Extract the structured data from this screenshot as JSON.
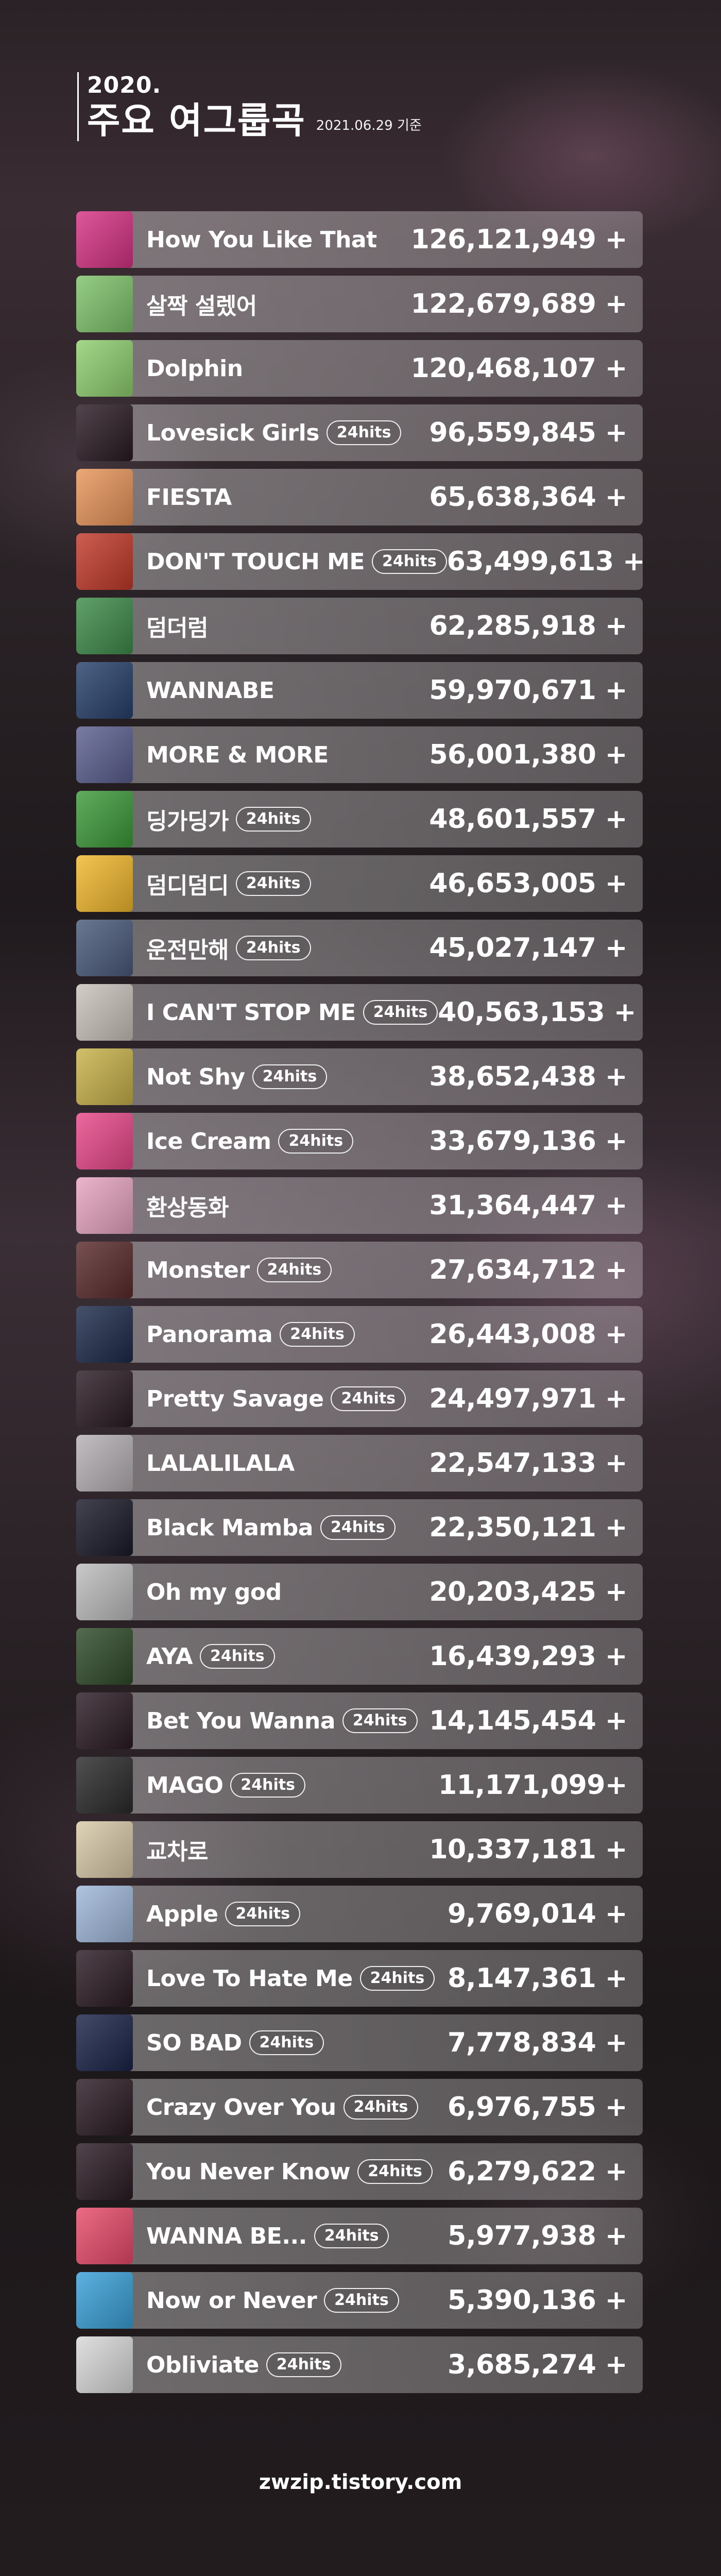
{
  "header": {
    "year": "2020.",
    "title": "주요 여그룹곡",
    "date": "2021.06.29 기준"
  },
  "songs": [
    {
      "title": "How You Like That",
      "badge": "",
      "count": "126,121,949 +",
      "thumb_color": "#d63384"
    },
    {
      "title": "살짝 설렜어",
      "badge": "",
      "count": "122,679,689 +",
      "thumb_color": "#7fc36b"
    },
    {
      "title": "Dolphin",
      "badge": "",
      "count": "120,468,107 +",
      "thumb_color": "#8fcf70"
    },
    {
      "title": "Lovesick Girls",
      "badge": "24hits",
      "count": "96,559,845 +",
      "thumb_color": "#2b1b24"
    },
    {
      "title": "FIESTA",
      "badge": "",
      "count": "65,638,364 +",
      "thumb_color": "#e8955a"
    },
    {
      "title": "DON'T TOUCH ME",
      "badge": "24hits",
      "count": "63,499,613 +",
      "thumb_color": "#c23a2a"
    },
    {
      "title": "덤더럼",
      "badge": "",
      "count": "62,285,918 +",
      "thumb_color": "#3e8b4a"
    },
    {
      "title": "WANNABE",
      "badge": "",
      "count": "59,970,671 +",
      "thumb_color": "#27406b"
    },
    {
      "title": "MORE & MORE",
      "badge": "",
      "count": "56,001,380 +",
      "thumb_color": "#5b5f8f"
    },
    {
      "title": "딩가딩가",
      "badge": "24hits",
      "count": "48,601,557 +",
      "thumb_color": "#3d9a3a"
    },
    {
      "title": "덤디덤디",
      "badge": "24hits",
      "count": "46,653,005 +",
      "thumb_color": "#f1b82d"
    },
    {
      "title": "운전만해",
      "badge": "24hits",
      "count": "45,027,147 +",
      "thumb_color": "#4a5a7a"
    },
    {
      "title": "I CAN'T STOP ME",
      "badge": "24hits",
      "count": "40,563,153 +",
      "thumb_color": "#c9c3bb"
    },
    {
      "title": "Not Shy",
      "badge": "24hits",
      "count": "38,652,438 +",
      "thumb_color": "#c8b24a"
    },
    {
      "title": "Ice Cream",
      "badge": "24hits",
      "count": "33,679,136 +",
      "thumb_color": "#e8488a"
    },
    {
      "title": "환상동화",
      "badge": "",
      "count": "31,364,447 +",
      "thumb_color": "#e7a5c0"
    },
    {
      "title": "Monster",
      "badge": "24hits",
      "count": "27,634,712 +",
      "thumb_color": "#5a2b2b"
    },
    {
      "title": "Panorama",
      "badge": "24hits",
      "count": "26,443,008 +",
      "thumb_color": "#1d2a4a"
    },
    {
      "title": "Pretty Savage",
      "badge": "24hits",
      "count": "24,497,971 +",
      "thumb_color": "#2b1b24"
    },
    {
      "title": "LALALILALA",
      "badge": "",
      "count": "22,547,133 +",
      "thumb_color": "#b5b0b5"
    },
    {
      "title": "Black Mamba",
      "badge": "24hits",
      "count": "22,350,121 +",
      "thumb_color": "#1a1a2a"
    },
    {
      "title": "Oh my god",
      "badge": "",
      "count": "20,203,425 +",
      "thumb_color": "#bdbdbd"
    },
    {
      "title": "AYA",
      "badge": "24hits",
      "count": "16,439,293 +",
      "thumb_color": "#2f4a2a"
    },
    {
      "title": "Bet You Wanna",
      "badge": "24hits",
      "count": "14,145,454 +",
      "thumb_color": "#2b1b24"
    },
    {
      "title": "MAGO",
      "badge": "24hits",
      "count": "11,171,099+",
      "thumb_color": "#2a2a2a"
    },
    {
      "title": "교차로",
      "badge": "",
      "count": "10,337,181 +",
      "thumb_color": "#d8c9a8"
    },
    {
      "title": "Apple",
      "badge": "24hits",
      "count": "9,769,014 +",
      "thumb_color": "#9fb7d9"
    },
    {
      "title": "Love To Hate Me",
      "badge": "24hits",
      "count": "8,147,361 +",
      "thumb_color": "#2b1b24"
    },
    {
      "title": "SO BAD",
      "badge": "24hits",
      "count": "7,778,834 +",
      "thumb_color": "#1a2348"
    },
    {
      "title": "Crazy Over You",
      "badge": "24hits",
      "count": "6,976,755 +",
      "thumb_color": "#2b1b24"
    },
    {
      "title": "You Never Know",
      "badge": "24hits",
      "count": "6,279,622 +",
      "thumb_color": "#2b1b24"
    },
    {
      "title": "WANNA BE...",
      "badge": "24hits",
      "count": "5,977,938 +",
      "thumb_color": "#e84a6a"
    },
    {
      "title": "Now or Never",
      "badge": "24hits",
      "count": "5,390,136 +",
      "thumb_color": "#3aa0d8"
    },
    {
      "title": "Obliviate",
      "badge": "24hits",
      "count": "3,685,274 +",
      "thumb_color": "#d9d9d9"
    }
  ],
  "footer": {
    "site": "zwzip.tistory.com"
  }
}
